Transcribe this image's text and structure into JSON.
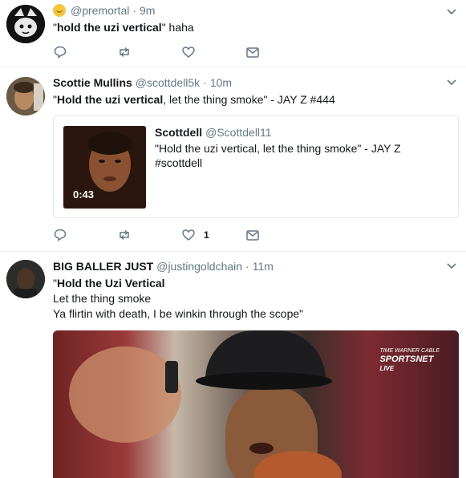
{
  "tweets": [
    {
      "name": "",
      "handle": "@premortal",
      "time": "9m",
      "text_quote_open": "\"",
      "text_bold": "hold the uzi vertical",
      "text_after": "\" haha",
      "actions": {
        "reply": "reply-icon",
        "retweet": "retweet-icon",
        "like": "heart-icon",
        "dm": "envelope-icon"
      }
    },
    {
      "name": "Scottie Mullins",
      "handle": "@scottdell5k",
      "time": "10m",
      "text_quote_open": "\"",
      "text_bold": "Hold the uzi vertical",
      "text_after": ", let the thing smoke\" - JAY Z #444",
      "quoted": {
        "name": "Scottdell",
        "handle": "@Scottdell11",
        "text": "\"Hold the uzi vertical, let the thing smoke\" - JAY Z #scottdell",
        "duration": "0:43"
      },
      "like_count": "1"
    },
    {
      "name": "BIG BALLER JUST",
      "handle": "@justingoldchain",
      "time": "11m",
      "text_quote_open": "\"",
      "text_bold": "Hold the Uzi Vertical",
      "line2": "Let the thing smoke",
      "line3": "Ya flirtin with death, I be winkin through the scope\"",
      "media_logo_small": "TIME WARNER CABLE",
      "media_logo": "SPORTSNET",
      "media_logo_live": "LIVE"
    }
  ],
  "separator": "·",
  "colors": {
    "secondary_text": "#657786",
    "border": "#e6ecf0",
    "text": "#14171a"
  }
}
